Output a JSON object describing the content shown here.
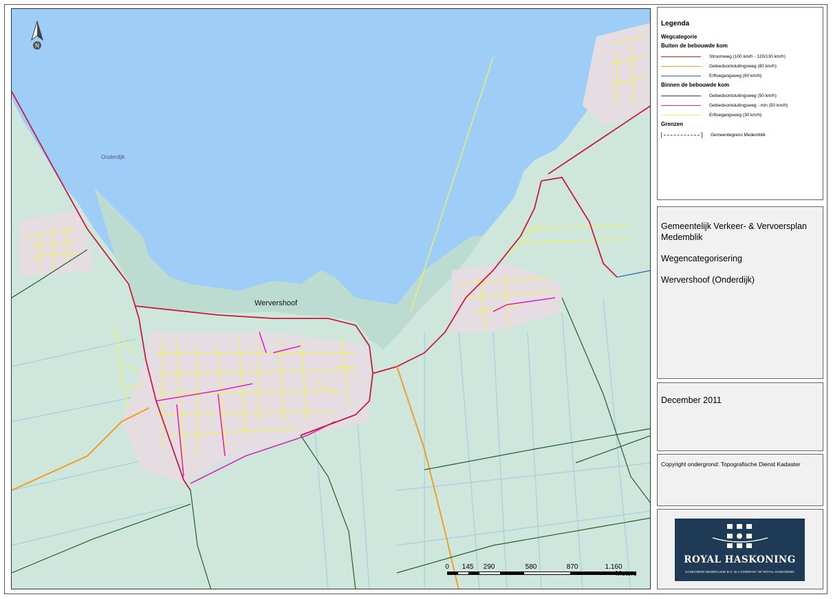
{
  "map": {
    "north_label": "N",
    "place_labels": {
      "wervershoof": "Wervershoof",
      "onderdijk": "Onderdijk"
    },
    "scale": {
      "ticks": [
        "0",
        "145",
        "290",
        "580",
        "870",
        "1.160"
      ],
      "unit": "Meters"
    },
    "colors": {
      "water": "#9ecdf8",
      "land": "#cfe6dc",
      "stroomweg": "#d42020",
      "gebiedsontsluiting80": "#f0a020",
      "erftoegang60": "#2a6fbd",
      "gebiedsontsluiting50": "#5a2a8a",
      "gebiedsontsluiting_min50": "#e020c0",
      "erftoegang30": "#f2f25a",
      "boundary": "#1e6e1e"
    }
  },
  "legend": {
    "title": "Legenda",
    "subtitle": "Wegcategorie",
    "groups": [
      {
        "heading": "Buiten de bebouwde kom",
        "items": [
          {
            "label": "Stroomweg (100 km/h - 120/130 km/h)",
            "color": "#d42020"
          },
          {
            "label": "Gebiedsontsluitingsweg (80 km/h)",
            "color": "#f0a020"
          },
          {
            "label": "Erftoegangsweg (60 km/h)",
            "color": "#2a6fbd"
          }
        ]
      },
      {
        "heading": "Binnen de bebouwde kom",
        "items": [
          {
            "label": "Gebiedsontsluitingsweg (50 km/h)",
            "color": "#5a2a8a"
          },
          {
            "label": "Gebiedsontsluitingsweg - min (50 km/h)",
            "color": "#e020c0"
          },
          {
            "label": "Erftoegangsweg (30 km/h)",
            "color": "#f2f25a"
          }
        ]
      },
      {
        "heading": "Grenzen",
        "items": [
          {
            "label": "Gemeentegrens Medemblik",
            "color": "#555555"
          }
        ]
      }
    ]
  },
  "info": {
    "title": "Gemeentelijk Verkeer- & Vervoersplan Medemblik",
    "subtitle": "Wegencategorisering",
    "area": "Wervershoof (Onderdijk)",
    "date": "December 2011",
    "copyright": "Copyright ondergrond: Topografische Dienst Kadaster"
  },
  "logo": {
    "name": "ROYAL HASKONING",
    "tagline": "HASKONING NEDERLAND B.V. IS A COMPANY OF ROYAL HASKONING"
  }
}
